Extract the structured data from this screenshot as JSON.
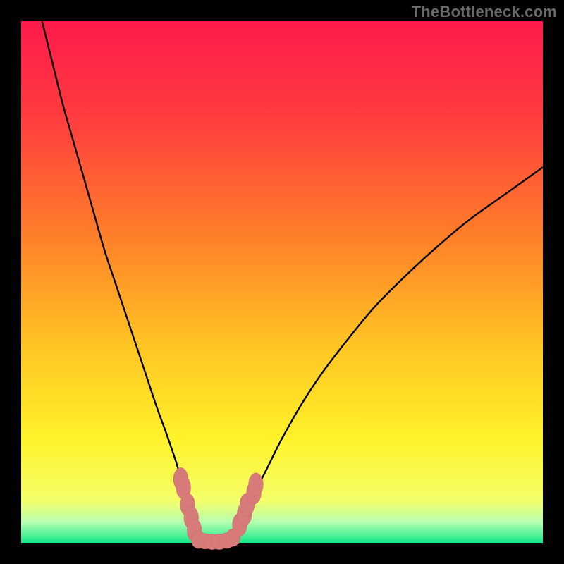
{
  "watermark": "TheBottleneck.com",
  "gradient": {
    "c0": "#ff1a4b",
    "c1": "#ff3b3f",
    "c2": "#ff7b2a",
    "c3": "#ffc423",
    "c4": "#fff22a",
    "c5": "#f4ff6a",
    "c6": "#b6ffb0",
    "c7": "#12e88a"
  },
  "chart_data": {
    "type": "line",
    "title": "",
    "xlabel": "",
    "ylabel": "",
    "xlim": [
      0,
      100
    ],
    "ylim": [
      0,
      100
    ],
    "series": [
      {
        "name": "left-curve",
        "x": [
          4,
          6,
          8,
          10,
          12,
          14,
          16,
          18,
          20,
          22,
          24,
          26,
          28,
          30,
          31,
          32,
          33,
          33.8
        ],
        "y": [
          100,
          92,
          84,
          77,
          70,
          63,
          56,
          50,
          44,
          38,
          32,
          26,
          20.5,
          14.5,
          10,
          6.5,
          3.5,
          0
        ]
      },
      {
        "name": "right-curve",
        "x": [
          40.5,
          42,
          44,
          47,
          50,
          54,
          58,
          63,
          68,
          74,
          80,
          86,
          93,
          100
        ],
        "y": [
          0,
          3.5,
          8,
          14,
          20,
          27,
          33,
          39.5,
          45.5,
          51.5,
          57,
          62,
          67,
          72
        ]
      },
      {
        "name": "bottom-flat",
        "x": [
          33.8,
          35,
          36.5,
          38,
          39.5,
          40.5
        ],
        "y": [
          0,
          0,
          0,
          0,
          0,
          0
        ]
      }
    ],
    "markers": [
      {
        "x": 30.6,
        "y": 12.2,
        "rx": 1.4,
        "ry": 2.2
      },
      {
        "x": 31.1,
        "y": 10.6,
        "rx": 1.4,
        "ry": 2.2
      },
      {
        "x": 31.9,
        "y": 7.3,
        "rx": 1.4,
        "ry": 2.2
      },
      {
        "x": 32.6,
        "y": 4.8,
        "rx": 1.4,
        "ry": 2.2
      },
      {
        "x": 33.2,
        "y": 2.4,
        "rx": 1.4,
        "ry": 2.2
      },
      {
        "x": 34.0,
        "y": 0.6,
        "rx": 1.4,
        "ry": 1.7
      },
      {
        "x": 35.2,
        "y": 0.3,
        "rx": 1.6,
        "ry": 1.5
      },
      {
        "x": 36.6,
        "y": 0.2,
        "rx": 1.6,
        "ry": 1.5
      },
      {
        "x": 38.0,
        "y": 0.2,
        "rx": 1.6,
        "ry": 1.5
      },
      {
        "x": 39.4,
        "y": 0.4,
        "rx": 1.6,
        "ry": 1.5
      },
      {
        "x": 40.6,
        "y": 1.0,
        "rx": 1.4,
        "ry": 1.7
      },
      {
        "x": 41.9,
        "y": 3.5,
        "rx": 1.4,
        "ry": 2.2
      },
      {
        "x": 42.8,
        "y": 5.5,
        "rx": 1.4,
        "ry": 2.2
      },
      {
        "x": 43.3,
        "y": 7.3,
        "rx": 1.4,
        "ry": 2.2
      },
      {
        "x": 44.6,
        "y": 9.6,
        "rx": 1.4,
        "ry": 2.2
      },
      {
        "x": 45.0,
        "y": 11.2,
        "rx": 1.4,
        "ry": 2.2
      }
    ]
  }
}
